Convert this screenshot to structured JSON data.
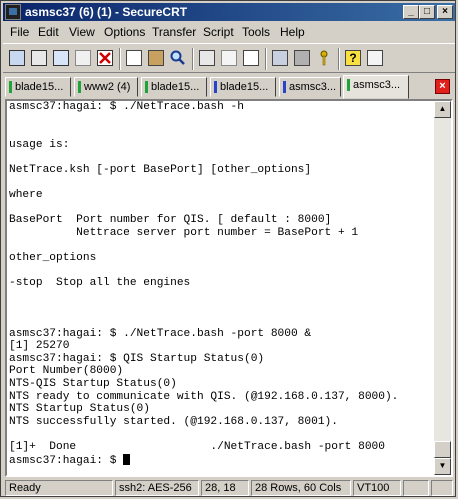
{
  "window": {
    "title": "asmsc37 (6) (1) - SecureCRT"
  },
  "menu": [
    "File",
    "Edit",
    "View",
    "Options",
    "Transfer",
    "Script",
    "Tools",
    "Help"
  ],
  "tabs": [
    {
      "label": "blade15...",
      "color": "#1fa33a"
    },
    {
      "label": "www2 (4)",
      "color": "#1fa33a"
    },
    {
      "label": "blade15...",
      "color": "#1fa33a"
    },
    {
      "label": "blade15...",
      "color": "#2a44c8"
    },
    {
      "label": "asmsc3...",
      "color": "#2a44c8"
    },
    {
      "label": "asmsc3...",
      "color": "#1fa33a"
    }
  ],
  "terminal": {
    "lines": [
      "asmsc37:hagai: $ ./NetTrace.bash -h",
      "",
      "",
      "usage is:",
      "",
      "NetTrace.ksh [-port BasePort] [other_options]",
      "",
      "where",
      "",
      "BasePort  Port number for QIS. [ default : 8000]",
      "          Nettrace server port number = BasePort + 1",
      "",
      "other_options",
      "",
      "-stop  Stop all the engines",
      "",
      "",
      "",
      "asmsc37:hagai: $ ./NetTrace.bash -port 8000 &",
      "[1] 25270",
      "asmsc37:hagai: $ QIS Startup Status(0)",
      "Port Number(8000)",
      "NTS-QIS Startup Status(0)",
      "NTS ready to communicate with QIS. (@192.168.0.137, 8000).",
      "NTS Startup Status(0)",
      "NTS successfully started. (@192.168.0.137, 8001).",
      "",
      "[1]+  Done                    ./NetTrace.bash -port 8000"
    ],
    "prompt": "asmsc37:hagai: $ "
  },
  "status": {
    "ready": "Ready",
    "cipher": "ssh2: AES-256",
    "cursor_pos": "28, 18",
    "size": "28 Rows, 60 Cols",
    "term_type": "VT100"
  }
}
